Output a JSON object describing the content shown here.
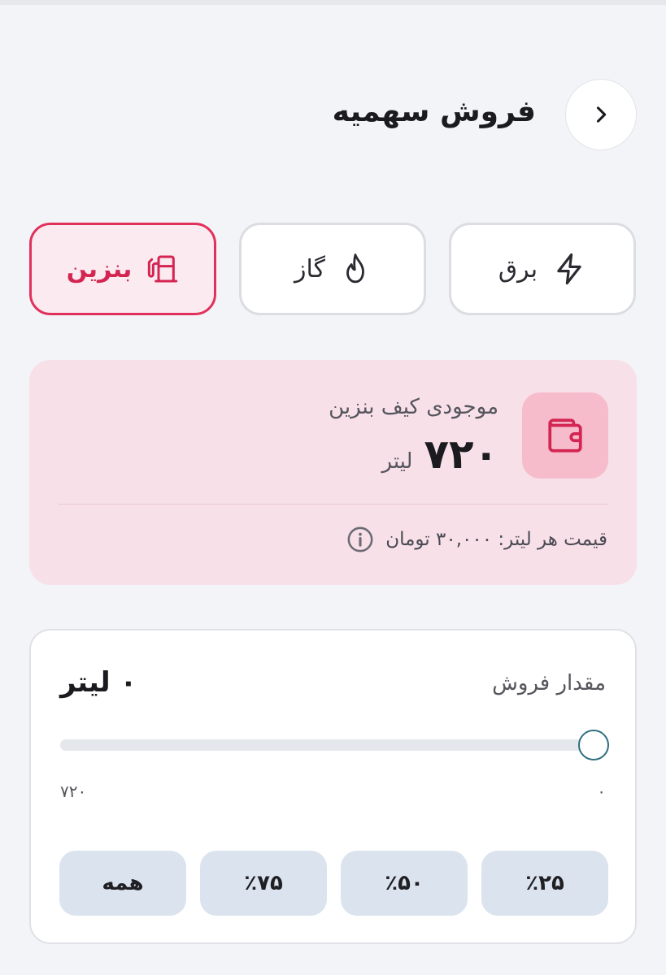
{
  "header": {
    "title": "فروش سهمیه"
  },
  "tabs": [
    {
      "label": "برق",
      "icon": "lightning-icon",
      "selected": false
    },
    {
      "label": "گاز",
      "icon": "flame-icon",
      "selected": false
    },
    {
      "label": "بنزین",
      "icon": "fuel-pump-icon",
      "selected": true
    }
  ],
  "balance": {
    "label": "موجودی کیف بنزین",
    "value": "۷۲۰",
    "unit": "لیتر",
    "price_text": "قیمت هر لیتر: ۳۰,۰۰۰ تومان",
    "icon": "wallet-icon"
  },
  "sell": {
    "label": "مقدار فروش",
    "value_text": "۰ لیتر",
    "slider_value": 0,
    "slider_min_label": "۰",
    "slider_max_label": "۷۲۰",
    "quick_buttons": [
      "٪۲۵",
      "٪۵۰",
      "٪۷۵",
      "همه"
    ]
  },
  "colors": {
    "accent": "#e0315c",
    "balance_bg": "#f8e0e9",
    "page_bg": "#f3f4f7",
    "quick_button_bg": "#dbe4ee",
    "slider_thumb_border": "#2e6f7e"
  }
}
